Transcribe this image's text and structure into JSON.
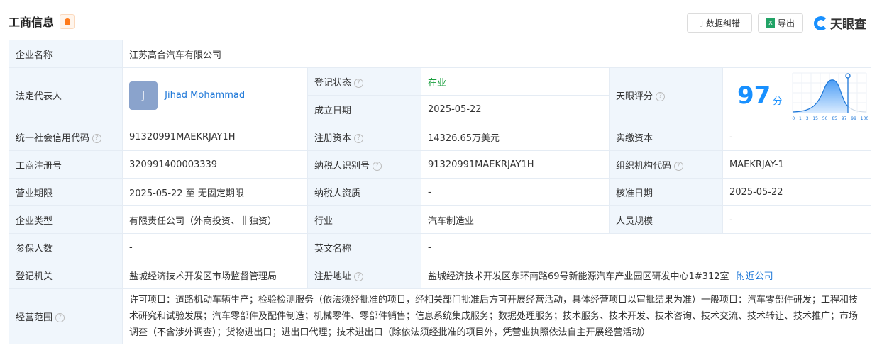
{
  "header": {
    "title": "工商信息",
    "correction_label": "数据纠错",
    "export_label": "导出",
    "logo": "天眼查"
  },
  "score": {
    "label": "天眼评分",
    "value": "97",
    "unit": "分",
    "value_num": 97,
    "ticks": [
      "0",
      "1",
      "3",
      "15",
      "50",
      "85",
      "97",
      "99",
      "100"
    ]
  },
  "rows": {
    "name": {
      "label": "企业名称",
      "value": "江苏高合汽车有限公司"
    },
    "legal": {
      "label": "法定代表人",
      "avatar": "J",
      "value": "Jihad Mohammad"
    },
    "status": {
      "label": "登记状态",
      "value": "在业"
    },
    "founded": {
      "label": "成立日期",
      "value": "2025-05-22"
    },
    "credit": {
      "label": "统一社会信用代码",
      "value": "91320991MAEKRJAY1H"
    },
    "capital": {
      "label": "注册资本",
      "value": "14326.65万美元"
    },
    "paid": {
      "label": "实缴资本",
      "value": "-"
    },
    "regno": {
      "label": "工商注册号",
      "value": "320991400003339"
    },
    "taxid": {
      "label": "纳税人识别号",
      "value": "91320991MAEKRJAY1H"
    },
    "orgcode": {
      "label": "组织机构代码",
      "value": "MAEKRJAY-1"
    },
    "term": {
      "label": "营业期限",
      "value": "2025-05-22 至 无固定期限"
    },
    "taxq": {
      "label": "纳税人资质",
      "value": "-"
    },
    "approve": {
      "label": "核准日期",
      "value": "2025-05-22"
    },
    "type": {
      "label": "企业类型",
      "value": "有限责任公司（外商投资、非独资）"
    },
    "industry": {
      "label": "行业",
      "value": "汽车制造业"
    },
    "staff": {
      "label": "人员规模",
      "value": "-"
    },
    "insured": {
      "label": "参保人数",
      "value": "-"
    },
    "english": {
      "label": "英文名称",
      "value": "-"
    },
    "authority": {
      "label": "登记机关",
      "value": "盐城经济技术开发区市场监督管理局"
    },
    "address": {
      "label": "注册地址",
      "value": "盐城经济技术开发区东环南路69号新能源汽车产业园区研发中心1#312室",
      "nearby": "附近公司"
    },
    "scope": {
      "label": "经营范围",
      "value": "许可项目：道路机动车辆生产；检验检测服务（依法须经批准的项目，经相关部门批准后方可开展经营活动，具体经营项目以审批结果为准）一般项目：汽车零部件研发；工程和技术研究和试验发展；汽车零部件及配件制造；机械零件、零部件销售；信息系统集成服务；数据处理服务；技术服务、技术开发、技术咨询、技术交流、技术转让、技术推广；市场调查（不含涉外调查）；货物进出口；进出口代理；技术进出口（除依法须经批准的项目外，凭营业执照依法自主开展经营活动）"
    }
  }
}
